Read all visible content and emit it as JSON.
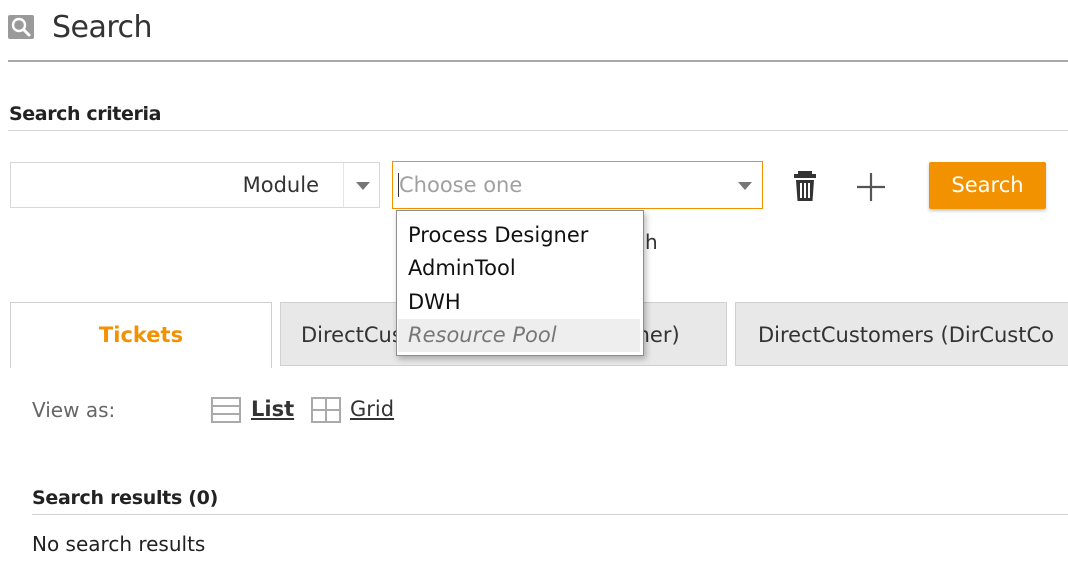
{
  "header": {
    "icon": "search-icon",
    "title": "Search"
  },
  "criteria": {
    "section_title": "Search criteria",
    "field_select": {
      "label": "Module"
    },
    "value_select": {
      "placeholder": "Choose one"
    },
    "delete_icon": "trash-icon",
    "add_icon": "plus-icon",
    "search_button": "Search",
    "partially_hidden_text": "ch"
  },
  "dropdown": {
    "options": [
      "Process Designer",
      "AdminTool",
      "DWH",
      "Resource Pool"
    ],
    "highlighted_index": 3
  },
  "tabs": [
    {
      "label": "Tickets",
      "active": true
    },
    {
      "label": "DirectCustomers (DirCustCustomer)",
      "active": false
    },
    {
      "label": "DirectCustomers (DirCustCo",
      "active": false
    }
  ],
  "view": {
    "label": "View as:",
    "list_label": "List",
    "grid_label": "Grid",
    "list_icon": "list-icon",
    "grid_icon": "grid-icon",
    "selected": "List"
  },
  "results": {
    "title": "Search results (0)",
    "empty_message": "No search results"
  },
  "colors": {
    "accent": "#f39200",
    "divider": "#a8a8a8",
    "tab_inactive_bg": "#e8e8e8"
  }
}
